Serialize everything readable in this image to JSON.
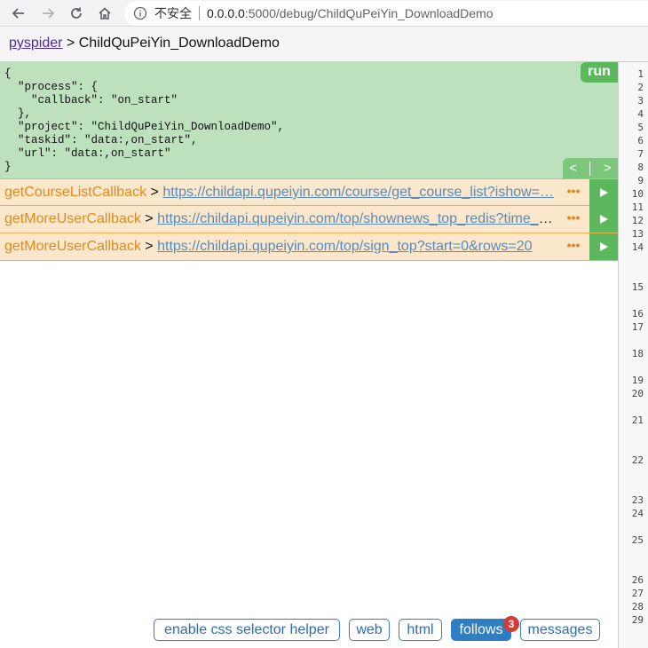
{
  "browser": {
    "security_text": "不安全",
    "url_host": "0.0.0.0",
    "url_path": ":5000/debug/ChildQuPeiYin_DownloadDemo"
  },
  "header": {
    "home_link": "pyspider",
    "separator": ">",
    "project_name": "ChildQuPeiYin_DownloadDemo"
  },
  "task": {
    "json_lines": [
      "{",
      "  \"process\": {",
      "    \"callback\": \"on_start\"",
      "  },",
      "  \"project\": \"ChildQuPeiYin_DownloadDemo\",",
      "  \"taskid\": \"data:,on_start\",",
      "  \"url\": \"data:,on_start\"",
      "}"
    ],
    "run_label": "run",
    "prev_label": "<",
    "next_label": ">"
  },
  "follows": [
    {
      "callback": "getCourseListCallback",
      "sep": ">",
      "url": "https://childapi.qupeiyin.com/course/get_course_list?ishow=…",
      "more": "•••"
    },
    {
      "callback": "getMoreUserCallback",
      "sep": ">",
      "url": "https://childapi.qupeiyin.com/top/shownews_top_redis?time_t…",
      "more": "•••"
    },
    {
      "callback": "getMoreUserCallback",
      "sep": ">",
      "url": "https://childapi.qupeiyin.com/top/sign_top?start=0&rows=20",
      "more": "•••"
    }
  ],
  "gutter_numbers": [
    "1",
    "2",
    "3",
    "4",
    "5",
    "6",
    "7",
    "8",
    "9",
    "10",
    "11",
    "12",
    "13",
    "14",
    "15",
    "16",
    "17",
    "18",
    "19",
    "20",
    "21",
    "22",
    "23",
    "24",
    "25",
    "26",
    "27",
    "28",
    "29"
  ],
  "toolbar": {
    "css_helper": "enable css selector helper",
    "web": "web",
    "html": "html",
    "follows": "follows",
    "follows_badge": "3",
    "messages": "messages"
  },
  "colors": {
    "task_bg": "#bde0bd",
    "run_green": "#5cb85c",
    "follow_bg": "#fbe8cc",
    "callback_orange": "#e08a1e",
    "active_blue": "#2f7ec2",
    "badge_red": "#d33b3b"
  }
}
